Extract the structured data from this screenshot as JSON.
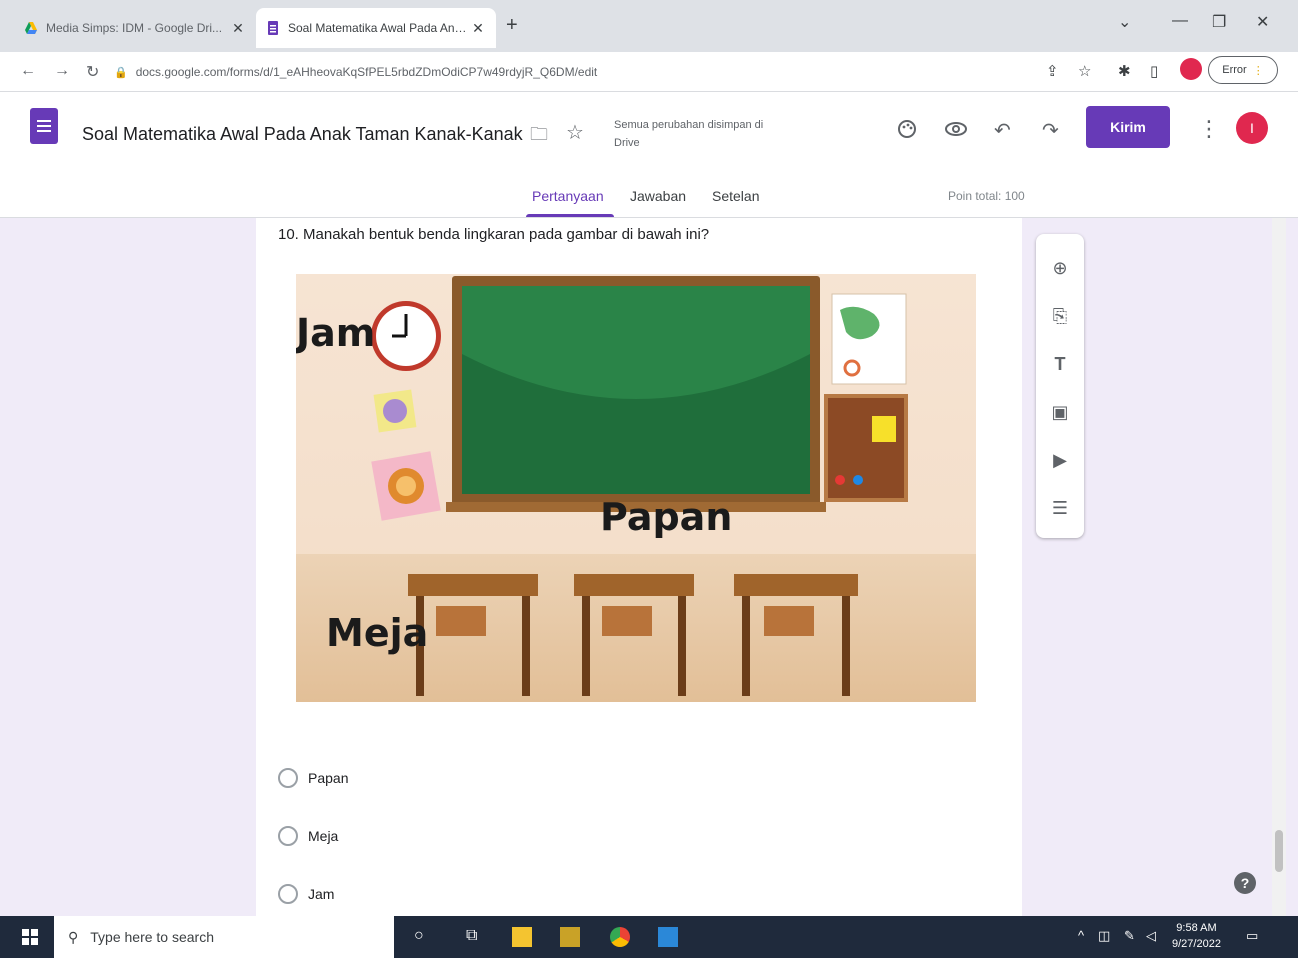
{
  "browser": {
    "tabs": [
      {
        "title": "Media Simps: IDM - Google Dri...",
        "favicon": "google-drive-icon",
        "close": "✕"
      },
      {
        "title": "Soal Matematika Awal Pada Ana...",
        "favicon": "google-forms-icon",
        "close": "✕"
      }
    ],
    "new_tab": "+",
    "url": "docs.google.com/forms/d/1_eAHheovaKqSfPEL5rbdZDmOdiCP7w49rdyjR_Q6DM/edit",
    "error_label": "Error"
  },
  "form": {
    "title": "Soal Matematika Awal Pada Anak Taman Kanak-Kanak",
    "save_status": "Semua perubahan disimpan di Drive",
    "send_label": "Kirim",
    "avatar_letter": "I",
    "tabs": [
      {
        "label": "Pertanyaan"
      },
      {
        "label": "Jawaban"
      },
      {
        "label": "Setelan"
      }
    ],
    "points_total": "Poin total: 100",
    "question": "10. Manakah bentuk benda lingkaran pada gambar di bawah ini?",
    "illustration_labels": {
      "clock": "Jam",
      "board": "Papan",
      "desk": "Meja"
    },
    "options": [
      {
        "label": "Papan"
      },
      {
        "label": "Meja"
      },
      {
        "label": "Jam"
      }
    ],
    "help_glyph": "?"
  },
  "taskbar": {
    "search_placeholder": "Type here to search",
    "time": "9:58 AM",
    "date": "9/27/2022"
  },
  "colors": {
    "accent": "#673ab7",
    "profile": "#e0284f",
    "page_bg": "#f0ebf8"
  }
}
